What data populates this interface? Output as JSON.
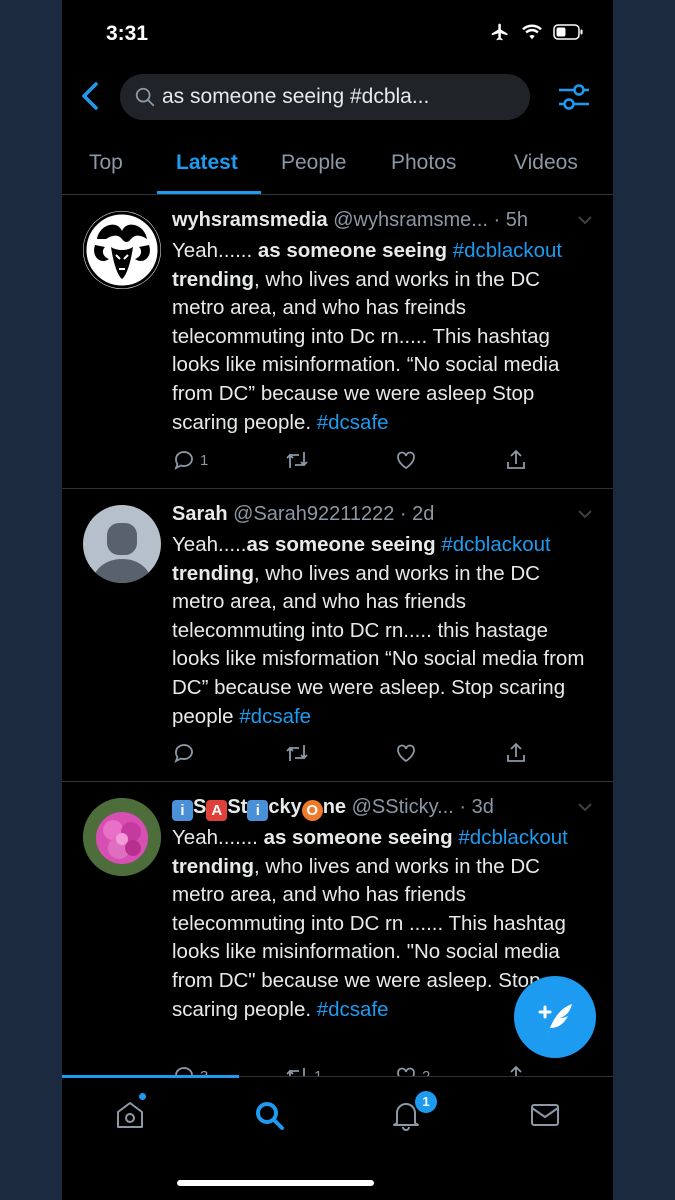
{
  "status_bar": {
    "time": "3:31"
  },
  "search": {
    "query": "as someone seeing #dcbla..."
  },
  "tabs": [
    {
      "label": "Top",
      "active": false
    },
    {
      "label": "Latest",
      "active": true
    },
    {
      "label": "People",
      "active": false
    },
    {
      "label": "Photos",
      "active": false
    },
    {
      "label": "Videos",
      "active": false
    }
  ],
  "tweets": [
    {
      "name": "wyhsramsmedia",
      "handle": "@wyhsramsme...",
      "time": "· 5h",
      "body": [
        {
          "t": "Yeah...... ",
          "s": "n"
        },
        {
          "t": "as someone seeing",
          "s": "b"
        },
        {
          "t": " ",
          "s": "n"
        },
        {
          "t": "#dcblackout",
          "s": "tag"
        },
        {
          "t": " trending",
          "s": "b"
        },
        {
          "t": ", who lives and works in the DC metro area, and who has freinds telecommuting into Dc rn..... This hashtag looks like misinformation. “No social media from DC” because we were asleep Stop scaring people. ",
          "s": "n"
        },
        {
          "t": "#dcsafe",
          "s": "tag"
        }
      ],
      "counts": {
        "reply": "1",
        "retweet": "",
        "like": ""
      }
    },
    {
      "name": "Sarah",
      "handle": "@Sarah92211222",
      "time": "· 2d",
      "body": [
        {
          "t": "Yeah.....",
          "s": "n"
        },
        {
          "t": "as someone seeing",
          "s": "b"
        },
        {
          "t": " ",
          "s": "n"
        },
        {
          "t": "#dcblackout",
          "s": "tag"
        },
        {
          "t": " trending",
          "s": "b"
        },
        {
          "t": ", who lives and works in the DC metro area, and who has friends telecommuting into DC rn..... this hastage looks like misformation “No social media from DC” because we were asleep. Stop scaring people ",
          "s": "n"
        },
        {
          "t": "#dcsafe",
          "s": "tag"
        }
      ],
      "counts": {
        "reply": "",
        "retweet": "",
        "like": ""
      }
    },
    {
      "name_parts": [
        {
          "t": "i",
          "box": "blue"
        },
        {
          "t": "S",
          "box": ""
        },
        {
          "t": "A",
          "box": "red"
        },
        {
          "t": "St",
          "box": ""
        },
        {
          "t": "i",
          "box": "blue"
        },
        {
          "t": "cky",
          "box": ""
        },
        {
          "t": "O",
          "box": "orange"
        },
        {
          "t": "ne",
          "box": ""
        }
      ],
      "handle": "@SSticky...",
      "time": "· 3d",
      "body": [
        {
          "t": "Yeah....... ",
          "s": "n"
        },
        {
          "t": "as someone seeing",
          "s": "b"
        },
        {
          "t": " ",
          "s": "n"
        },
        {
          "t": "#dcblackout",
          "s": "tag"
        },
        {
          "t": " trending",
          "s": "b"
        },
        {
          "t": ", who lives and works in the DC metro area, and who has friends telecommuting into DC rn ...... This hashtag looks like misinformation. \"No social media from DC\" because we were asleep. Stop scaring people. ",
          "s": "n"
        },
        {
          "t": "#dcsafe",
          "s": "tag"
        }
      ],
      "counts": {
        "reply": "3",
        "retweet": "1",
        "like": "2"
      }
    }
  ],
  "notifications_badge": "1",
  "colors": {
    "accent": "#1d9bf0",
    "background": "#000000",
    "muted": "#8b98a5",
    "outer": "#1c2a3f"
  },
  "icons": [
    "back-icon",
    "search-icon",
    "filter-icon",
    "reply-icon",
    "retweet-icon",
    "like-icon",
    "share-icon",
    "home-icon",
    "bell-icon",
    "mail-icon",
    "compose-icon"
  ]
}
